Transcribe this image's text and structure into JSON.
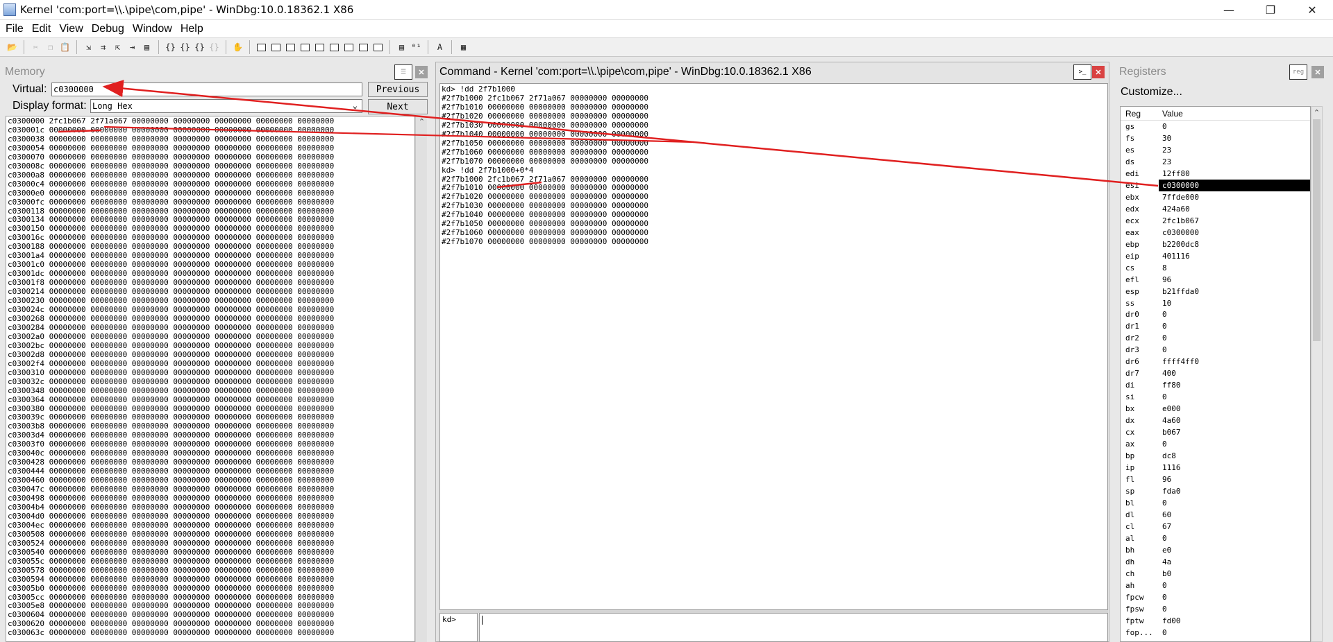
{
  "window": {
    "title": "Kernel 'com:port=\\\\.\\pipe\\com,pipe' - WinDbg:10.0.18362.1 X86",
    "minimize": "—",
    "maximize": "❐",
    "close": "✕"
  },
  "menu": [
    "File",
    "Edit",
    "View",
    "Debug",
    "Window",
    "Help"
  ],
  "toolbar_icons": [
    "open-icon",
    "cut-icon",
    "copy-icon",
    "paste-icon",
    "step-into-icon",
    "step-over-icon",
    "step-out-icon",
    "run-to-cursor-icon",
    "go-icon",
    "break-icon",
    "restart-icon",
    "hand-icon",
    "command-window-icon",
    "watch-window-icon",
    "locals-window-icon",
    "registers-window-icon",
    "memory-window-icon",
    "call-stack-icon",
    "disassembly-icon",
    "scratch-pad-icon",
    "source-mode-icon",
    "hex-mode-icon",
    "font-icon",
    "options-icon"
  ],
  "memory": {
    "title": "Memory",
    "virtual_label": "Virtual:",
    "virtual_value": "c0300000",
    "format_label": "Display format:",
    "format_value": "Long Hex",
    "previous_label": "Previous",
    "next_label": "Next",
    "rows": [
      [
        "c0300000",
        "2fc1b067",
        "2f71a067",
        "00000000",
        "00000000",
        "00000000",
        "00000000",
        "00000000"
      ],
      [
        "c030001c",
        "00000000",
        "00000000",
        "00000000",
        "00000000",
        "00000000",
        "00000000",
        "00000000"
      ],
      [
        "c0300038",
        "00000000",
        "00000000",
        "00000000",
        "00000000",
        "00000000",
        "00000000",
        "00000000"
      ],
      [
        "c0300054",
        "00000000",
        "00000000",
        "00000000",
        "00000000",
        "00000000",
        "00000000",
        "00000000"
      ],
      [
        "c0300070",
        "00000000",
        "00000000",
        "00000000",
        "00000000",
        "00000000",
        "00000000",
        "00000000"
      ],
      [
        "c030008c",
        "00000000",
        "00000000",
        "00000000",
        "00000000",
        "00000000",
        "00000000",
        "00000000"
      ],
      [
        "c03000a8",
        "00000000",
        "00000000",
        "00000000",
        "00000000",
        "00000000",
        "00000000",
        "00000000"
      ],
      [
        "c03000c4",
        "00000000",
        "00000000",
        "00000000",
        "00000000",
        "00000000",
        "00000000",
        "00000000"
      ],
      [
        "c03000e0",
        "00000000",
        "00000000",
        "00000000",
        "00000000",
        "00000000",
        "00000000",
        "00000000"
      ],
      [
        "c03000fc",
        "00000000",
        "00000000",
        "00000000",
        "00000000",
        "00000000",
        "00000000",
        "00000000"
      ],
      [
        "c0300118",
        "00000000",
        "00000000",
        "00000000",
        "00000000",
        "00000000",
        "00000000",
        "00000000"
      ],
      [
        "c0300134",
        "00000000",
        "00000000",
        "00000000",
        "00000000",
        "00000000",
        "00000000",
        "00000000"
      ],
      [
        "c0300150",
        "00000000",
        "00000000",
        "00000000",
        "00000000",
        "00000000",
        "00000000",
        "00000000"
      ],
      [
        "c030016c",
        "00000000",
        "00000000",
        "00000000",
        "00000000",
        "00000000",
        "00000000",
        "00000000"
      ],
      [
        "c0300188",
        "00000000",
        "00000000",
        "00000000",
        "00000000",
        "00000000",
        "00000000",
        "00000000"
      ],
      [
        "c03001a4",
        "00000000",
        "00000000",
        "00000000",
        "00000000",
        "00000000",
        "00000000",
        "00000000"
      ],
      [
        "c03001c0",
        "00000000",
        "00000000",
        "00000000",
        "00000000",
        "00000000",
        "00000000",
        "00000000"
      ],
      [
        "c03001dc",
        "00000000",
        "00000000",
        "00000000",
        "00000000",
        "00000000",
        "00000000",
        "00000000"
      ],
      [
        "c03001f8",
        "00000000",
        "00000000",
        "00000000",
        "00000000",
        "00000000",
        "00000000",
        "00000000"
      ],
      [
        "c0300214",
        "00000000",
        "00000000",
        "00000000",
        "00000000",
        "00000000",
        "00000000",
        "00000000"
      ],
      [
        "c0300230",
        "00000000",
        "00000000",
        "00000000",
        "00000000",
        "00000000",
        "00000000",
        "00000000"
      ],
      [
        "c030024c",
        "00000000",
        "00000000",
        "00000000",
        "00000000",
        "00000000",
        "00000000",
        "00000000"
      ],
      [
        "c0300268",
        "00000000",
        "00000000",
        "00000000",
        "00000000",
        "00000000",
        "00000000",
        "00000000"
      ],
      [
        "c0300284",
        "00000000",
        "00000000",
        "00000000",
        "00000000",
        "00000000",
        "00000000",
        "00000000"
      ],
      [
        "c03002a0",
        "00000000",
        "00000000",
        "00000000",
        "00000000",
        "00000000",
        "00000000",
        "00000000"
      ],
      [
        "c03002bc",
        "00000000",
        "00000000",
        "00000000",
        "00000000",
        "00000000",
        "00000000",
        "00000000"
      ],
      [
        "c03002d8",
        "00000000",
        "00000000",
        "00000000",
        "00000000",
        "00000000",
        "00000000",
        "00000000"
      ],
      [
        "c03002f4",
        "00000000",
        "00000000",
        "00000000",
        "00000000",
        "00000000",
        "00000000",
        "00000000"
      ],
      [
        "c0300310",
        "00000000",
        "00000000",
        "00000000",
        "00000000",
        "00000000",
        "00000000",
        "00000000"
      ],
      [
        "c030032c",
        "00000000",
        "00000000",
        "00000000",
        "00000000",
        "00000000",
        "00000000",
        "00000000"
      ],
      [
        "c0300348",
        "00000000",
        "00000000",
        "00000000",
        "00000000",
        "00000000",
        "00000000",
        "00000000"
      ],
      [
        "c0300364",
        "00000000",
        "00000000",
        "00000000",
        "00000000",
        "00000000",
        "00000000",
        "00000000"
      ],
      [
        "c0300380",
        "00000000",
        "00000000",
        "00000000",
        "00000000",
        "00000000",
        "00000000",
        "00000000"
      ],
      [
        "c030039c",
        "00000000",
        "00000000",
        "00000000",
        "00000000",
        "00000000",
        "00000000",
        "00000000"
      ],
      [
        "c03003b8",
        "00000000",
        "00000000",
        "00000000",
        "00000000",
        "00000000",
        "00000000",
        "00000000"
      ],
      [
        "c03003d4",
        "00000000",
        "00000000",
        "00000000",
        "00000000",
        "00000000",
        "00000000",
        "00000000"
      ],
      [
        "c03003f0",
        "00000000",
        "00000000",
        "00000000",
        "00000000",
        "00000000",
        "00000000",
        "00000000"
      ],
      [
        "c030040c",
        "00000000",
        "00000000",
        "00000000",
        "00000000",
        "00000000",
        "00000000",
        "00000000"
      ],
      [
        "c0300428",
        "00000000",
        "00000000",
        "00000000",
        "00000000",
        "00000000",
        "00000000",
        "00000000"
      ],
      [
        "c0300444",
        "00000000",
        "00000000",
        "00000000",
        "00000000",
        "00000000",
        "00000000",
        "00000000"
      ],
      [
        "c0300460",
        "00000000",
        "00000000",
        "00000000",
        "00000000",
        "00000000",
        "00000000",
        "00000000"
      ],
      [
        "c030047c",
        "00000000",
        "00000000",
        "00000000",
        "00000000",
        "00000000",
        "00000000",
        "00000000"
      ],
      [
        "c0300498",
        "00000000",
        "00000000",
        "00000000",
        "00000000",
        "00000000",
        "00000000",
        "00000000"
      ],
      [
        "c03004b4",
        "00000000",
        "00000000",
        "00000000",
        "00000000",
        "00000000",
        "00000000",
        "00000000"
      ],
      [
        "c03004d0",
        "00000000",
        "00000000",
        "00000000",
        "00000000",
        "00000000",
        "00000000",
        "00000000"
      ],
      [
        "c03004ec",
        "00000000",
        "00000000",
        "00000000",
        "00000000",
        "00000000",
        "00000000",
        "00000000"
      ],
      [
        "c0300508",
        "00000000",
        "00000000",
        "00000000",
        "00000000",
        "00000000",
        "00000000",
        "00000000"
      ],
      [
        "c0300524",
        "00000000",
        "00000000",
        "00000000",
        "00000000",
        "00000000",
        "00000000",
        "00000000"
      ],
      [
        "c0300540",
        "00000000",
        "00000000",
        "00000000",
        "00000000",
        "00000000",
        "00000000",
        "00000000"
      ],
      [
        "c030055c",
        "00000000",
        "00000000",
        "00000000",
        "00000000",
        "00000000",
        "00000000",
        "00000000"
      ],
      [
        "c0300578",
        "00000000",
        "00000000",
        "00000000",
        "00000000",
        "00000000",
        "00000000",
        "00000000"
      ],
      [
        "c0300594",
        "00000000",
        "00000000",
        "00000000",
        "00000000",
        "00000000",
        "00000000",
        "00000000"
      ],
      [
        "c03005b0",
        "00000000",
        "00000000",
        "00000000",
        "00000000",
        "00000000",
        "00000000",
        "00000000"
      ],
      [
        "c03005cc",
        "00000000",
        "00000000",
        "00000000",
        "00000000",
        "00000000",
        "00000000",
        "00000000"
      ],
      [
        "c03005e8",
        "00000000",
        "00000000",
        "00000000",
        "00000000",
        "00000000",
        "00000000",
        "00000000"
      ],
      [
        "c0300604",
        "00000000",
        "00000000",
        "00000000",
        "00000000",
        "00000000",
        "00000000",
        "00000000"
      ],
      [
        "c0300620",
        "00000000",
        "00000000",
        "00000000",
        "00000000",
        "00000000",
        "00000000",
        "00000000"
      ],
      [
        "c030063c",
        "00000000",
        "00000000",
        "00000000",
        "00000000",
        "00000000",
        "00000000",
        "00000000"
      ]
    ]
  },
  "command": {
    "title": "Command - Kernel 'com:port=\\\\.\\pipe\\com,pipe' - WinDbg:10.0.18362.1 X86",
    "output": [
      "kd> !dd 2f7b1000",
      "#2f7b1000 2fc1b067 2f71a067 00000000 00000000",
      "#2f7b1010 00000000 00000000 00000000 00000000",
      "#2f7b1020 00000000 00000000 00000000 00000000",
      "#2f7b1030 00000000 00000000 00000000 00000000",
      "#2f7b1040 00000000 00000000 00000000 00000000",
      "#2f7b1050 00000000 00000000 00000000 00000000",
      "#2f7b1060 00000000 00000000 00000000 00000000",
      "#2f7b1070 00000000 00000000 00000000 00000000",
      "kd> !dd 2f7b1000+0*4",
      "#2f7b1000 2fc1b067 2f71a067 00000000 00000000",
      "#2f7b1010 00000000 00000000 00000000 00000000",
      "#2f7b1020 00000000 00000000 00000000 00000000",
      "#2f7b1030 00000000 00000000 00000000 00000000",
      "#2f7b1040 00000000 00000000 00000000 00000000",
      "#2f7b1050 00000000 00000000 00000000 00000000",
      "#2f7b1060 00000000 00000000 00000000 00000000",
      "#2f7b1070 00000000 00000000 00000000 00000000"
    ],
    "prompt": "kd>",
    "input_value": ""
  },
  "registers": {
    "title": "Registers",
    "customize": "Customize...",
    "col_reg": "Reg",
    "col_value": "Value",
    "selected": "esi",
    "rows": [
      [
        "gs",
        "0"
      ],
      [
        "fs",
        "30"
      ],
      [
        "es",
        "23"
      ],
      [
        "ds",
        "23"
      ],
      [
        "edi",
        "12ff80"
      ],
      [
        "esi",
        "c0300000"
      ],
      [
        "ebx",
        "7ffde000"
      ],
      [
        "edx",
        "424a60"
      ],
      [
        "ecx",
        "2fc1b067"
      ],
      [
        "eax",
        "c0300000"
      ],
      [
        "ebp",
        "b2200dc8"
      ],
      [
        "eip",
        "401116"
      ],
      [
        "cs",
        "8"
      ],
      [
        "efl",
        "96"
      ],
      [
        "esp",
        "b21ffda0"
      ],
      [
        "ss",
        "10"
      ],
      [
        "dr0",
        "0"
      ],
      [
        "dr1",
        "0"
      ],
      [
        "dr2",
        "0"
      ],
      [
        "dr3",
        "0"
      ],
      [
        "dr6",
        "ffff4ff0"
      ],
      [
        "dr7",
        "400"
      ],
      [
        "di",
        "ff80"
      ],
      [
        "si",
        "0"
      ],
      [
        "bx",
        "e000"
      ],
      [
        "dx",
        "4a60"
      ],
      [
        "cx",
        "b067"
      ],
      [
        "ax",
        "0"
      ],
      [
        "bp",
        "dc8"
      ],
      [
        "ip",
        "1116"
      ],
      [
        "fl",
        "96"
      ],
      [
        "sp",
        "fda0"
      ],
      [
        "bl",
        "0"
      ],
      [
        "dl",
        "60"
      ],
      [
        "cl",
        "67"
      ],
      [
        "al",
        "0"
      ],
      [
        "bh",
        "e0"
      ],
      [
        "dh",
        "4a"
      ],
      [
        "ch",
        "b0"
      ],
      [
        "ah",
        "0"
      ],
      [
        "fpcw",
        "0"
      ],
      [
        "fpsw",
        "0"
      ],
      [
        "fptw",
        "fd00"
      ],
      [
        "fop...",
        "0"
      ]
    ]
  },
  "annotation_color": "#e02020"
}
